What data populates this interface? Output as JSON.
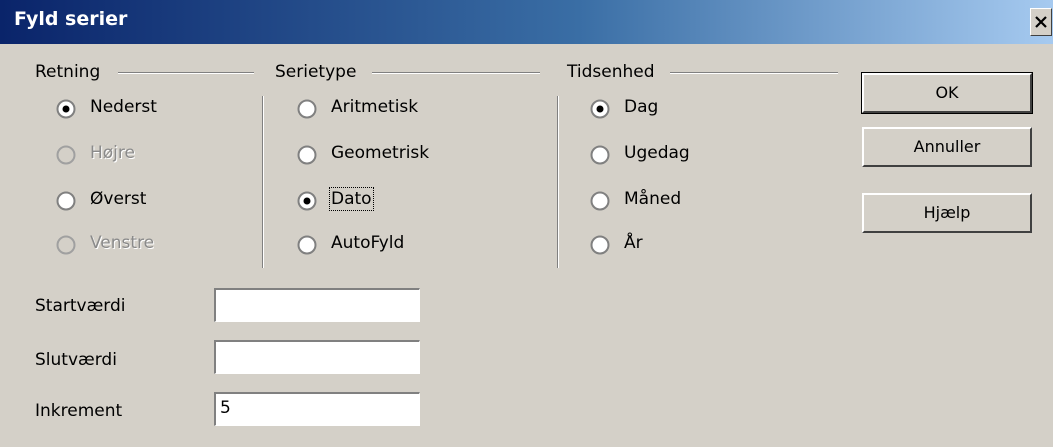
{
  "window": {
    "title": "Fyld serier",
    "close_label": "Luk"
  },
  "direction": {
    "heading": "Retning",
    "options": [
      {
        "label": "Nederst",
        "selected": true,
        "enabled": true
      },
      {
        "label": "Højre",
        "selected": false,
        "enabled": false
      },
      {
        "label": "Øverst",
        "selected": false,
        "enabled": true
      },
      {
        "label": "Venstre",
        "selected": false,
        "enabled": false
      }
    ]
  },
  "series_type": {
    "heading": "Serietype",
    "options": [
      {
        "label": "Aritmetisk",
        "selected": false,
        "enabled": true
      },
      {
        "label": "Geometrisk",
        "selected": false,
        "enabled": true
      },
      {
        "label": "Dato",
        "selected": true,
        "enabled": true,
        "focused": true
      },
      {
        "label": "AutoFyld",
        "selected": false,
        "enabled": true
      }
    ]
  },
  "time_unit": {
    "heading": "Tidsenhed",
    "options": [
      {
        "label": "Dag",
        "selected": true,
        "enabled": true
      },
      {
        "label": "Ugedag",
        "selected": false,
        "enabled": true
      },
      {
        "label": "Måned",
        "selected": false,
        "enabled": true
      },
      {
        "label": "År",
        "selected": false,
        "enabled": true
      }
    ]
  },
  "fields": {
    "start": {
      "label": "Startværdi",
      "value": ""
    },
    "end": {
      "label": "Slutværdi",
      "value": ""
    },
    "increment": {
      "label": "Inkrement",
      "value": "5"
    }
  },
  "buttons": {
    "ok": "OK",
    "cancel": "Annuller",
    "help": "Hjælp"
  },
  "colors": {
    "face": "#d4d0c8",
    "title_start": "#0a246a",
    "title_end": "#a6caf0"
  }
}
